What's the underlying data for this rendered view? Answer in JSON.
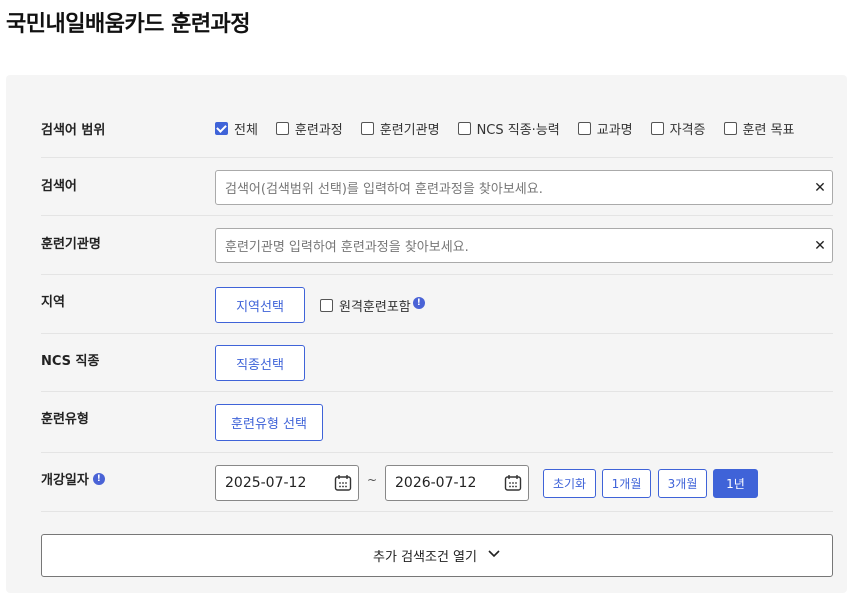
{
  "page_title": "국민내일배움카드 훈련과정",
  "scope": {
    "label": "검색어 범위",
    "options": [
      {
        "label": "전체",
        "checked": true
      },
      {
        "label": "훈련과정",
        "checked": false
      },
      {
        "label": "훈련기관명",
        "checked": false
      },
      {
        "label": "NCS 직종·능력",
        "checked": false
      },
      {
        "label": "교과명",
        "checked": false
      },
      {
        "label": "자격증",
        "checked": false
      },
      {
        "label": "훈련 목표",
        "checked": false
      }
    ]
  },
  "keyword": {
    "label": "검색어",
    "placeholder": "검색어(검색범위 선택)를 입력하여 훈련과정을 찾아보세요.",
    "clear": "✕"
  },
  "institution": {
    "label": "훈련기관명",
    "placeholder": "훈련기관명 입력하여 훈련과정을 찾아보세요.",
    "clear": "✕"
  },
  "region": {
    "label": "지역",
    "button": "지역선택",
    "remote_label": "원격훈련포함"
  },
  "ncs": {
    "label": "NCS 직종",
    "button": "직종선택"
  },
  "training_type": {
    "label": "훈련유형",
    "button": "훈련유형 선택"
  },
  "start_date": {
    "label": "개강일자",
    "from": "2025-07-12",
    "separator": "~",
    "to": "2026-07-12",
    "ranges": [
      {
        "label": "초기화",
        "active": false
      },
      {
        "label": "1개월",
        "active": false
      },
      {
        "label": "3개월",
        "active": false
      },
      {
        "label": "1년",
        "active": true
      }
    ]
  },
  "more_conditions": "추가 검색조건 열기",
  "colors": {
    "accent": "#3f63d8",
    "panel_bg": "#f5f5f5"
  }
}
